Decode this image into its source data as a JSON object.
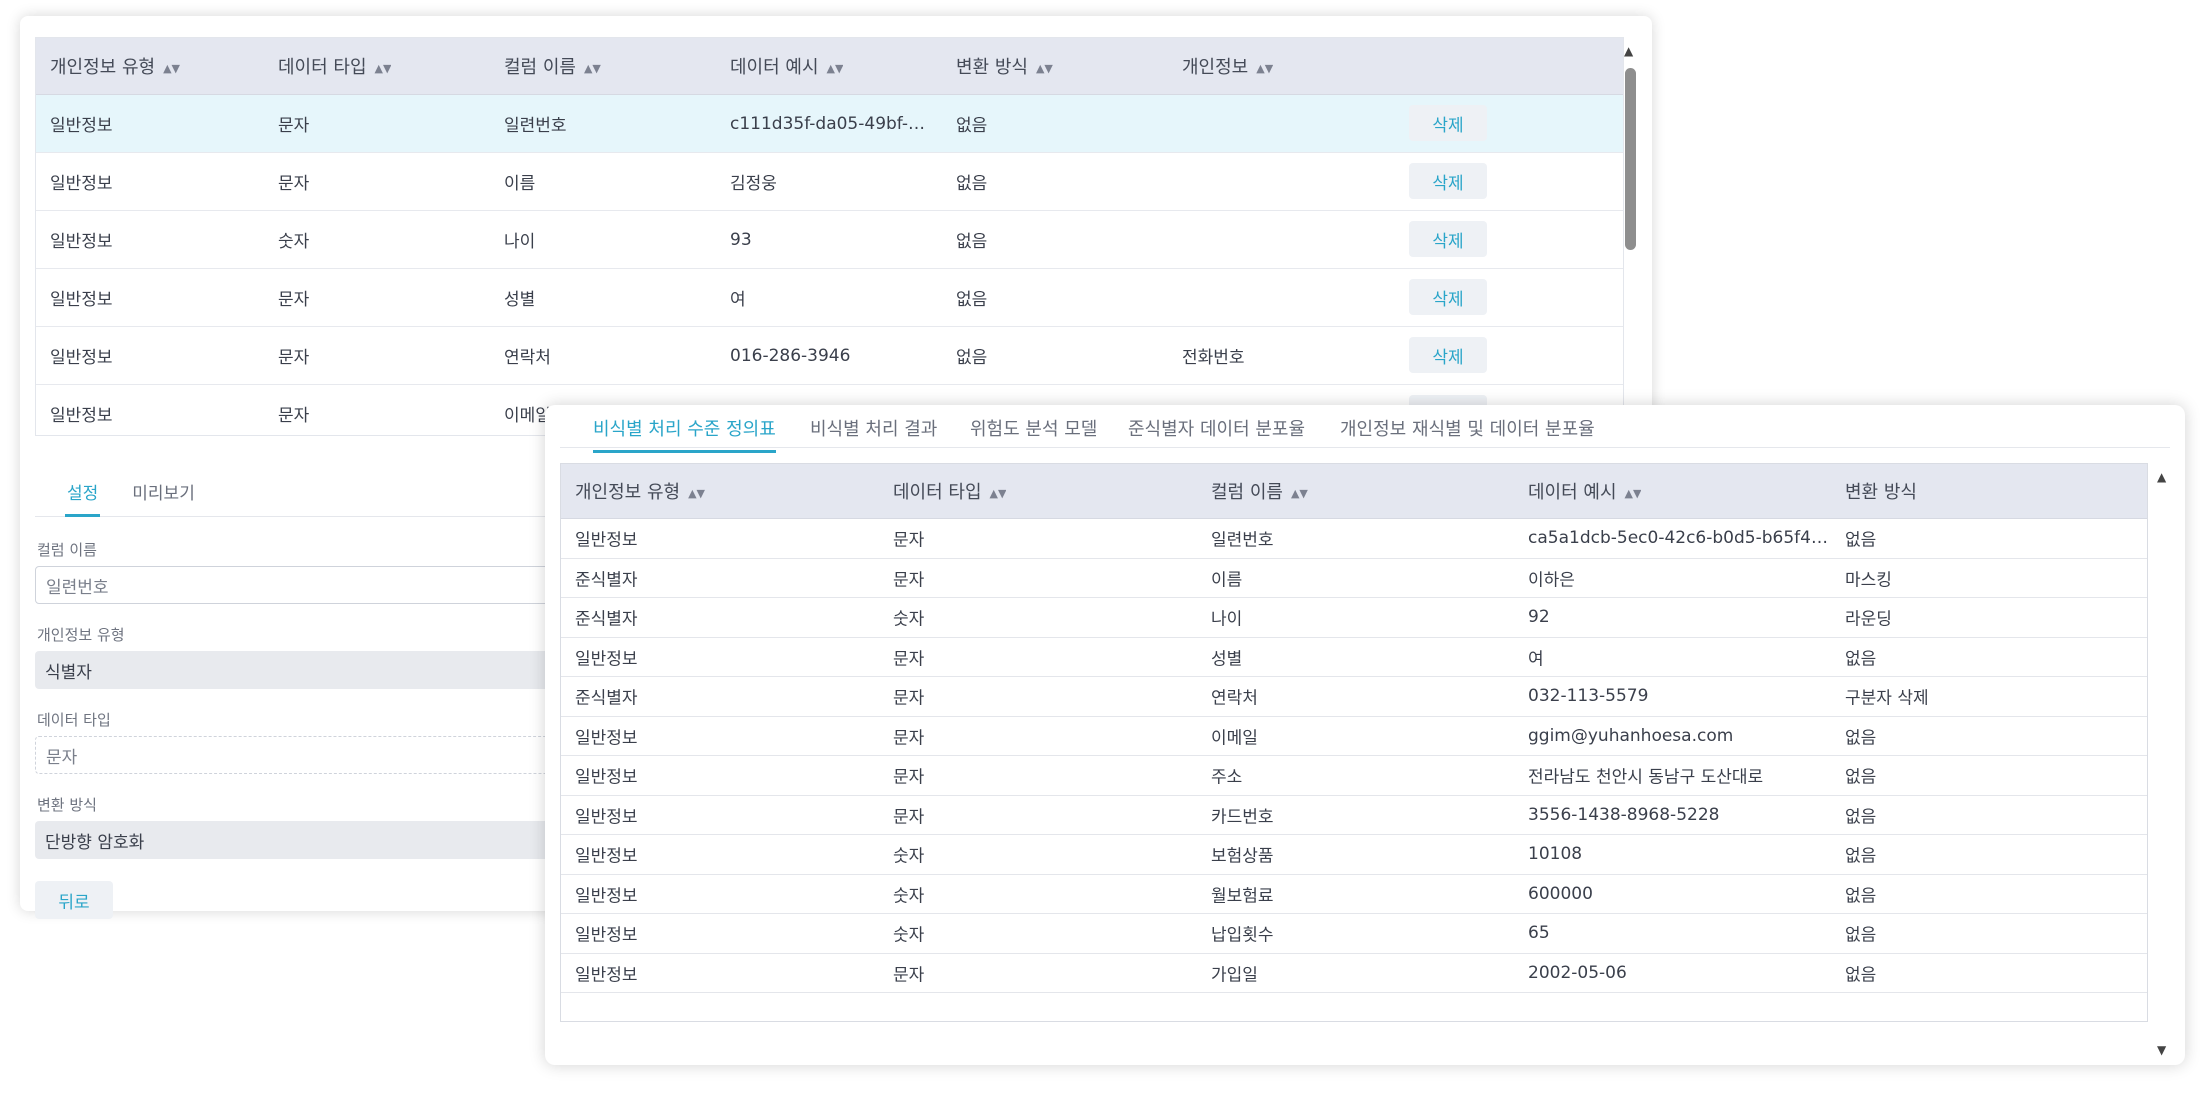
{
  "top_table": {
    "headers": [
      "개인정보 유형",
      "데이터 타입",
      "컬럼 이름",
      "데이터 예시",
      "변환 방식",
      "개인정보"
    ],
    "rows": [
      {
        "type": "일반정보",
        "dtype": "문자",
        "col": "일련번호",
        "example": "c111d35f-da05-49bf-ae2…",
        "method": "없음",
        "pii": "",
        "action": "삭제"
      },
      {
        "type": "일반정보",
        "dtype": "문자",
        "col": "이름",
        "example": "김정웅",
        "method": "없음",
        "pii": "",
        "action": "삭제"
      },
      {
        "type": "일반정보",
        "dtype": "숫자",
        "col": "나이",
        "example": "93",
        "method": "없음",
        "pii": "",
        "action": "삭제"
      },
      {
        "type": "일반정보",
        "dtype": "문자",
        "col": "성별",
        "example": "여",
        "method": "없음",
        "pii": "",
        "action": "삭제"
      },
      {
        "type": "일반정보",
        "dtype": "문자",
        "col": "연락처",
        "example": "016-286-3946",
        "method": "없음",
        "pii": "전화번호",
        "action": "삭제"
      },
      {
        "type": "일반정보",
        "dtype": "문자",
        "col": "이메일",
        "example": "",
        "method": "",
        "pii": "",
        "action": "삭제"
      }
    ]
  },
  "settings": {
    "tabs": [
      "설정",
      "미리보기"
    ],
    "fields": {
      "column_name_label": "컬럼 이름",
      "column_name_value": "일련번호",
      "pii_type_label": "개인정보 유형",
      "pii_type_value": "식별자",
      "data_type_label": "데이터 타입",
      "data_type_value": "문자",
      "method_label": "변환 방식",
      "method_value": "단방향 암호화"
    },
    "back_label": "뒤로"
  },
  "front": {
    "tabs": [
      "비식별 처리 수준 정의표",
      "비식별 처리 결과",
      "위험도 분석 모델",
      "준식별자 데이터 분포율",
      "개인정보 재식별 및 데이터 분포율"
    ],
    "headers": [
      "개인정보 유형",
      "데이터 타입",
      "컬럼 이름",
      "데이터 예시",
      "변환 방식"
    ],
    "rows": [
      {
        "type": "일반정보",
        "dtype": "문자",
        "col": "일련번호",
        "example": "ca5a1dcb-5ec0-42c6-b0d5-b65f45f4…",
        "method": "없음"
      },
      {
        "type": "준식별자",
        "dtype": "문자",
        "col": "이름",
        "example": "이하은",
        "method": "마스킹"
      },
      {
        "type": "준식별자",
        "dtype": "숫자",
        "col": "나이",
        "example": "92",
        "method": "라운딩"
      },
      {
        "type": "일반정보",
        "dtype": "문자",
        "col": "성별",
        "example": "여",
        "method": "없음"
      },
      {
        "type": "준식별자",
        "dtype": "문자",
        "col": "연락처",
        "example": "032-113-5579",
        "method": "구분자 삭제"
      },
      {
        "type": "일반정보",
        "dtype": "문자",
        "col": "이메일",
        "example": "ggim@yuhanhoesa.com",
        "method": "없음"
      },
      {
        "type": "일반정보",
        "dtype": "문자",
        "col": "주소",
        "example": "전라남도 천안시 동남구 도산대로",
        "method": "없음"
      },
      {
        "type": "일반정보",
        "dtype": "문자",
        "col": "카드번호",
        "example": "3556-1438-8968-5228",
        "method": "없음"
      },
      {
        "type": "일반정보",
        "dtype": "숫자",
        "col": "보험상품",
        "example": "10108",
        "method": "없음"
      },
      {
        "type": "일반정보",
        "dtype": "숫자",
        "col": "월보험료",
        "example": "600000",
        "method": "없음"
      },
      {
        "type": "일반정보",
        "dtype": "숫자",
        "col": "납입횟수",
        "example": "65",
        "method": "없음"
      },
      {
        "type": "일반정보",
        "dtype": "문자",
        "col": "가입일",
        "example": "2002-05-06",
        "method": "없음"
      }
    ]
  }
}
